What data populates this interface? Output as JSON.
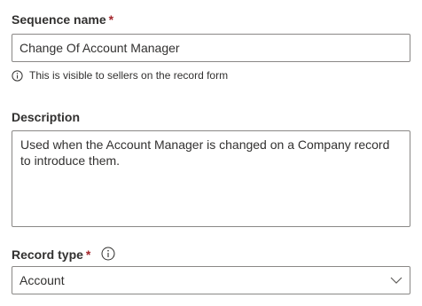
{
  "sequence_name": {
    "label": "Sequence name",
    "required_marker": "*",
    "value": "Change Of Account Manager",
    "hint": "This is visible to sellers on the record form"
  },
  "description": {
    "label": "Description",
    "value": "Used when the Account Manager is changed on a Company record to introduce them."
  },
  "record_type": {
    "label": "Record type",
    "required_marker": "*",
    "selected": "Account"
  },
  "icons": {
    "hint_icon": "info-icon",
    "record_type_info": "info-icon",
    "dropdown": "chevron-down-icon"
  },
  "colors": {
    "required": "#a4262c",
    "border": "#8a8886",
    "text": "#323130"
  }
}
